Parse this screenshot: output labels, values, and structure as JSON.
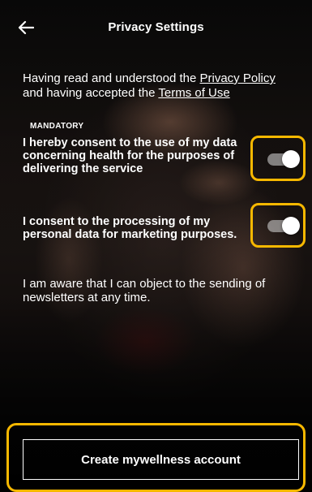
{
  "header": {
    "title": "Privacy Settings",
    "back_icon": "arrow-left-icon"
  },
  "intro": {
    "text_1": "Having read and understood the ",
    "privacy_policy_link": "Privacy Policy",
    "text_2": " and having accepted the ",
    "terms_link": "Terms of Use"
  },
  "consents": {
    "mandatory_label": "MANDATORY",
    "health_consent_text": "I hereby consent to the use of my data concerning health for the purposes of delivering the service",
    "health_consent_on": true,
    "marketing_consent_text": "I consent to the processing of my personal data for marketing purposes.",
    "marketing_consent_on": true
  },
  "note": "I am aware that I can object to the sending of newsletters at any time.",
  "cta": {
    "label": "Create mywellness account"
  },
  "colors": {
    "highlight": "#f7b800",
    "text": "#ffffff",
    "toggle_track": "#c8c8c8",
    "toggle_knob": "#ffffff"
  }
}
